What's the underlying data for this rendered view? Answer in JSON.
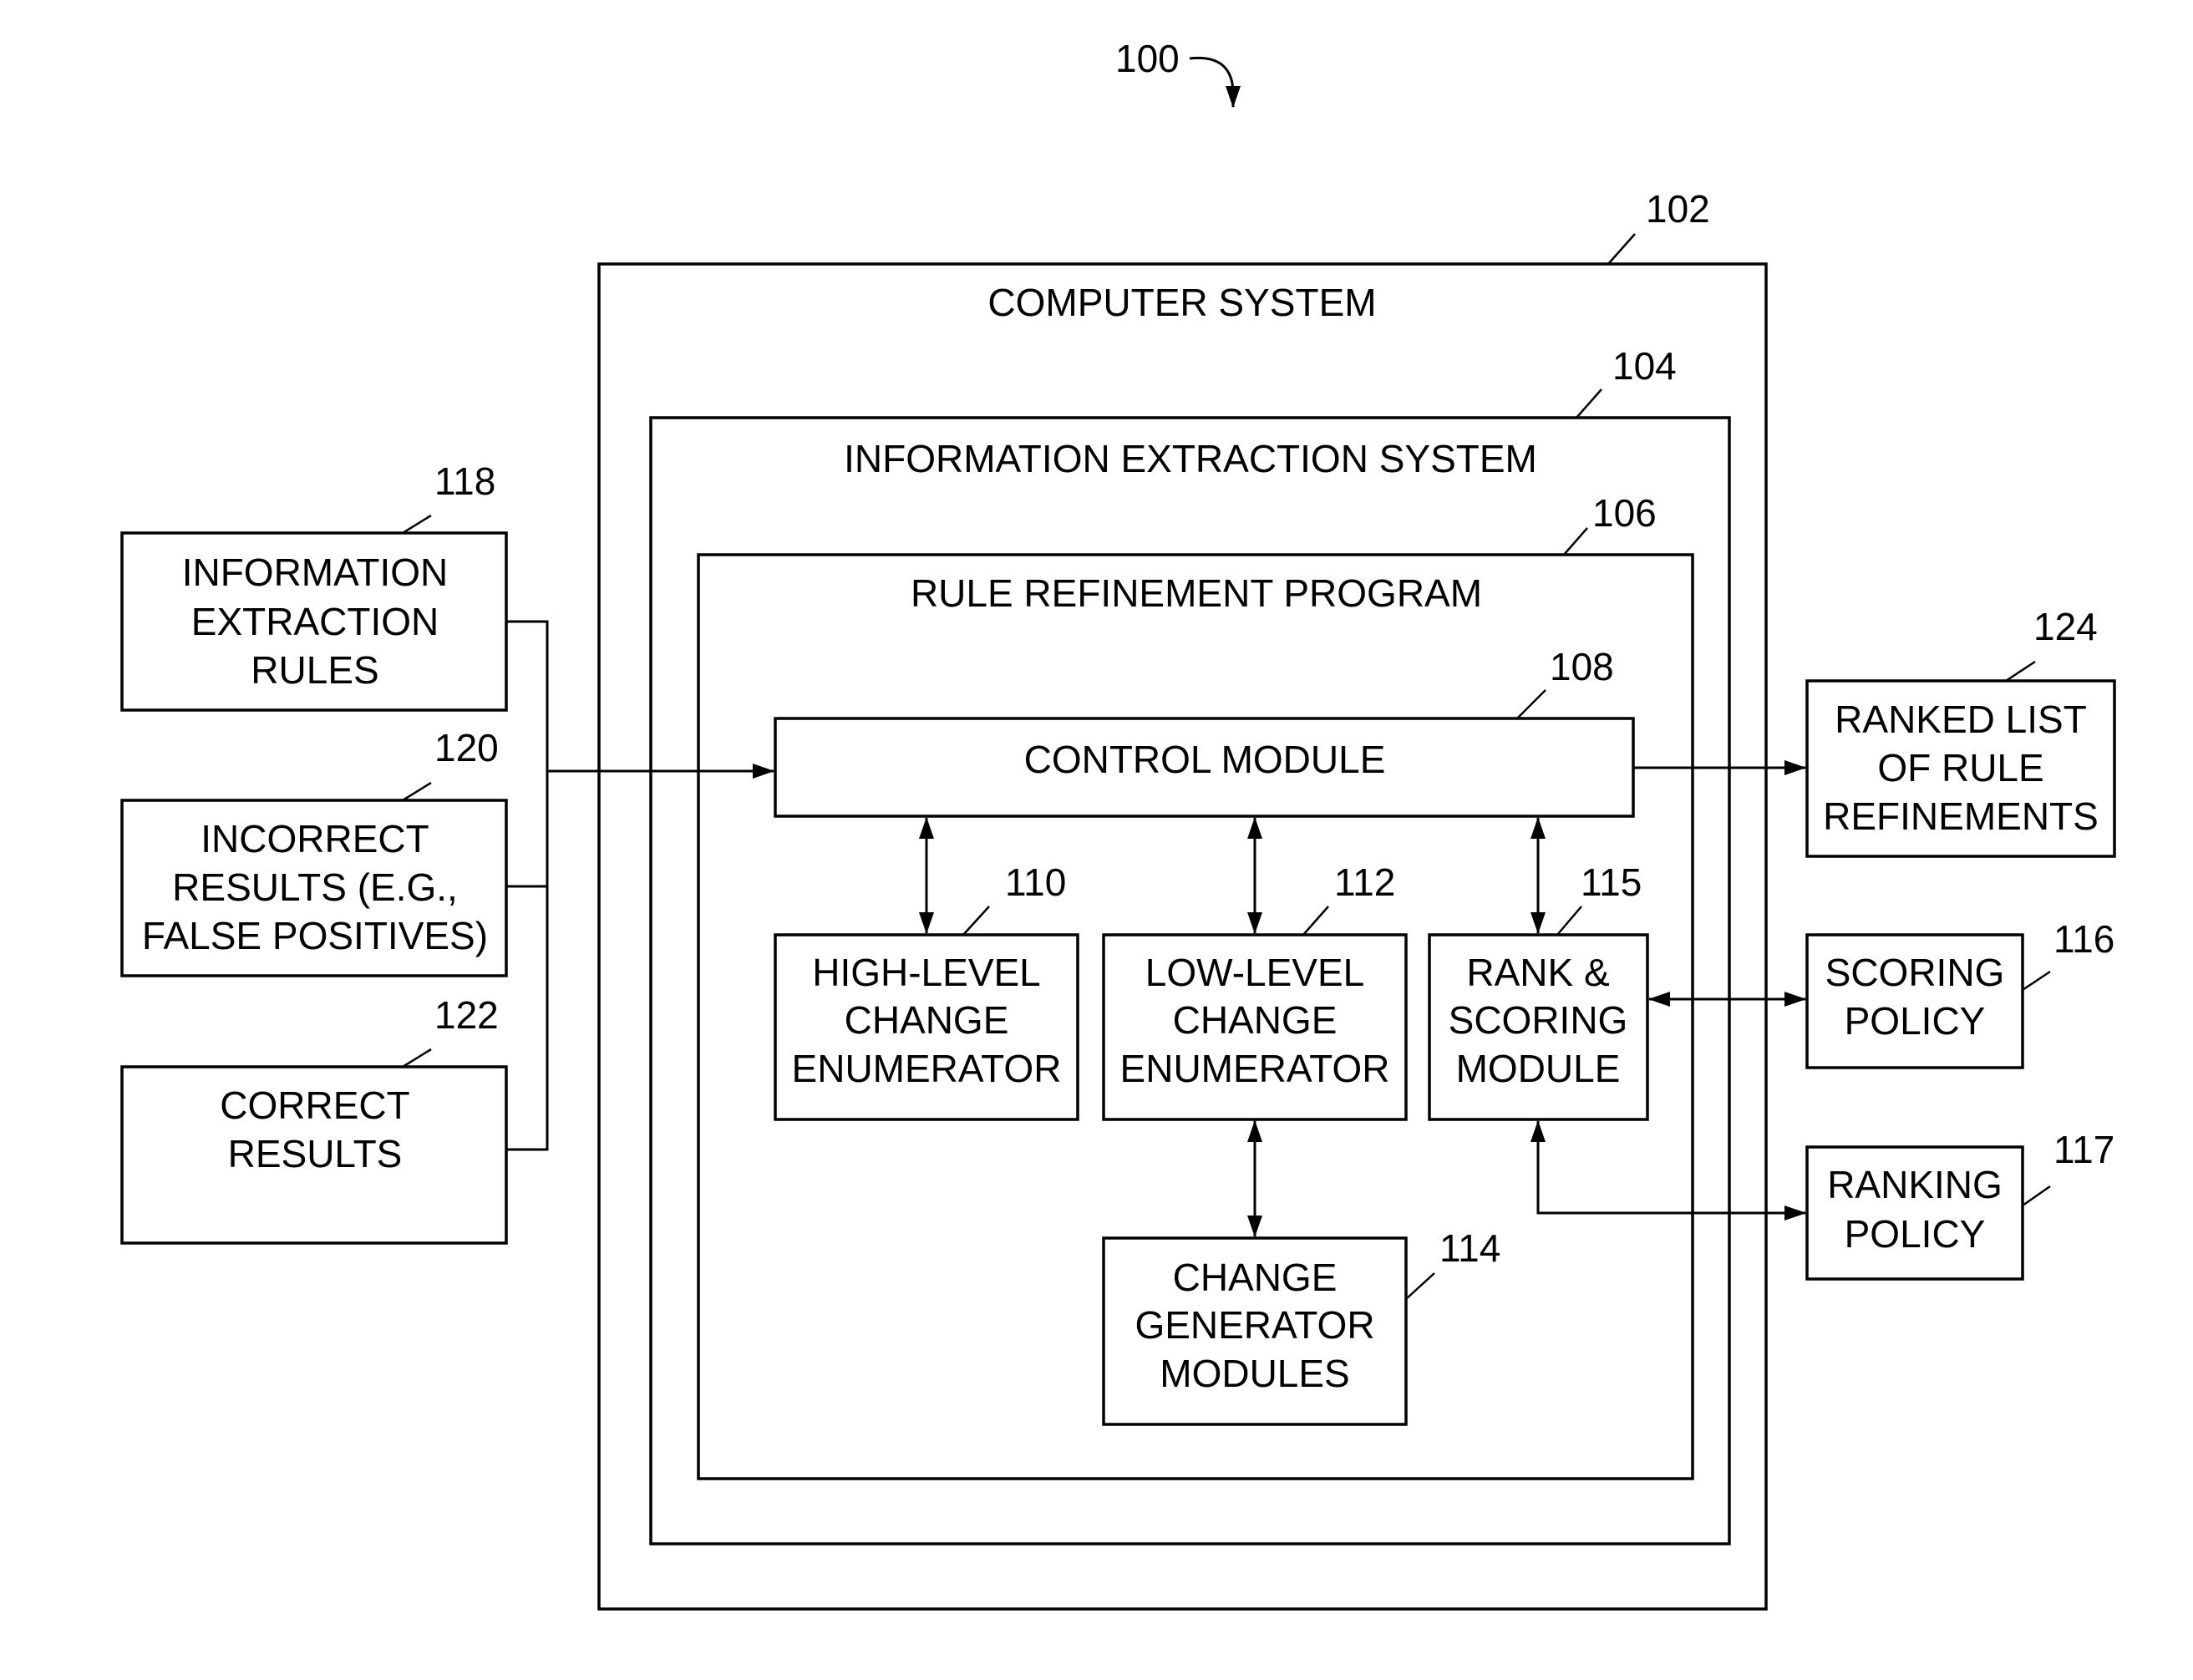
{
  "figure": {
    "ref": "100",
    "nodes": {
      "computer_system": {
        "ref": "102",
        "label": "COMPUTER SYSTEM"
      },
      "info_extraction_system": {
        "ref": "104",
        "label": "INFORMATION EXTRACTION SYSTEM"
      },
      "rule_refinement_program": {
        "ref": "106",
        "label": "RULE REFINEMENT PROGRAM"
      },
      "control_module": {
        "ref": "108",
        "label": "CONTROL MODULE"
      },
      "high_level_enum": {
        "ref": "110",
        "lines": [
          "HIGH-LEVEL",
          "CHANGE",
          "ENUMERATOR"
        ]
      },
      "low_level_enum": {
        "ref": "112",
        "lines": [
          "LOW-LEVEL",
          "CHANGE",
          "ENUMERATOR"
        ]
      },
      "rank_scoring": {
        "ref": "115",
        "lines": [
          "RANK &",
          "SCORING",
          "MODULE"
        ]
      },
      "change_generator": {
        "ref": "114",
        "lines": [
          "CHANGE",
          "GENERATOR",
          "MODULES"
        ]
      },
      "ie_rules": {
        "ref": "118",
        "lines": [
          "INFORMATION",
          "EXTRACTION",
          "RULES"
        ]
      },
      "incorrect_results": {
        "ref": "120",
        "lines": [
          "INCORRECT",
          "RESULTS (E.G.,",
          "FALSE POSITIVES)"
        ]
      },
      "correct_results": {
        "ref": "122",
        "lines": [
          "CORRECT",
          "RESULTS"
        ]
      },
      "ranked_list": {
        "ref": "124",
        "lines": [
          "RANKED LIST",
          "OF RULE",
          "REFINEMENTS"
        ]
      },
      "scoring_policy": {
        "ref": "116",
        "lines": [
          "SCORING",
          "POLICY"
        ]
      },
      "ranking_policy": {
        "ref": "117",
        "lines": [
          "RANKING",
          "POLICY"
        ]
      }
    }
  }
}
